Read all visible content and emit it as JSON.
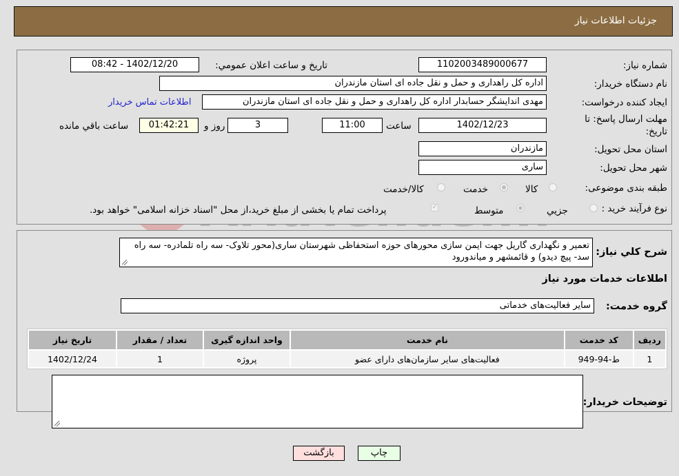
{
  "header": {
    "title": "جزئیات اطلاعات نیاز"
  },
  "form": {
    "need_number_label": "شماره نیاز:",
    "need_number": "1102003489000677",
    "announce_label": "تاریخ و ساعت اعلان عمومي:",
    "announce_value": "1402/12/20 - 08:42",
    "buyer_org_label": "نام دستگاه خریدار:",
    "buyer_org": "اداره کل راهداری و حمل و نقل جاده ای استان مازندران",
    "creator_label": "ایجاد کننده درخواست:",
    "creator": "مهدی اندایشگر حسابدار اداره کل راهداری و حمل و نقل جاده ای استان مازندران",
    "contact_link": "اطلاعات تماس خریدار",
    "deadline_label": "مهلت ارسال پاسخ: تا تاریخ:",
    "deadline_date": "1402/12/23",
    "time_label": "ساعت",
    "deadline_time": "11:00",
    "days_value": "3",
    "days_label": "روز و",
    "remaining_time": "01:42:21",
    "remaining_label": "ساعت باقي مانده",
    "province_label": "استان محل تحویل:",
    "province": "مازندران",
    "city_label": "شهر محل تحویل:",
    "city": "ساری",
    "category_label": "طبقه بندی موضوعی:",
    "category_options": [
      {
        "label": "کالا",
        "checked": false
      },
      {
        "label": "خدمت",
        "checked": true
      },
      {
        "label": "کالا/خدمت",
        "checked": false
      }
    ],
    "process_label": "نوع فرآیند خرید :",
    "process_options": [
      {
        "label": "جزيي",
        "checked": false
      },
      {
        "label": "متوسط",
        "checked": true
      }
    ],
    "treasury_note": "پرداخت تمام یا بخشی از مبلغ خرید،از محل \"اسناد خزانه اسلامی\" خواهد بود.",
    "treasury_checked": true
  },
  "description": {
    "label": "شرح کلي نیاز:",
    "text": "تعمیر و نگهداری گاریل جهت ایمن سازی محورهای حوزه استحفاظی شهرستان ساری(محور تلاوک- سه راه تلمادره- سه راه سد- پیچ دیدو) و قائمشهر و میاندورود"
  },
  "services": {
    "section_title": "اطلاعات خدمات مورد نیاز",
    "group_label": "گروه خدمت:",
    "group_value": "سایر فعالیت‌های خدماتی",
    "table": {
      "headers": [
        "ردیف",
        "کد خدمت",
        "نام خدمت",
        "واحد اندازه گیری",
        "تعداد / مقدار",
        "تاریخ نیاز"
      ],
      "rows": [
        [
          "1",
          "ط-94-949",
          "فعالیت‌های سایر سازمان‌های دارای عضو",
          "پروژه",
          "1",
          "1402/12/24"
        ]
      ]
    }
  },
  "buyer_notes": {
    "label": "توضیحات خریدار:",
    "value": ""
  },
  "buttons": {
    "print": "چاپ",
    "back": "بازگشت"
  },
  "watermark": {
    "text": "AriaTender.neT"
  },
  "colors": {
    "header_bg": "#8c6d43",
    "link": "#2222cc",
    "back_btn": "#ffdede",
    "print_btn": "#e8ffe6",
    "remaining_bg": "#ffffe6"
  }
}
